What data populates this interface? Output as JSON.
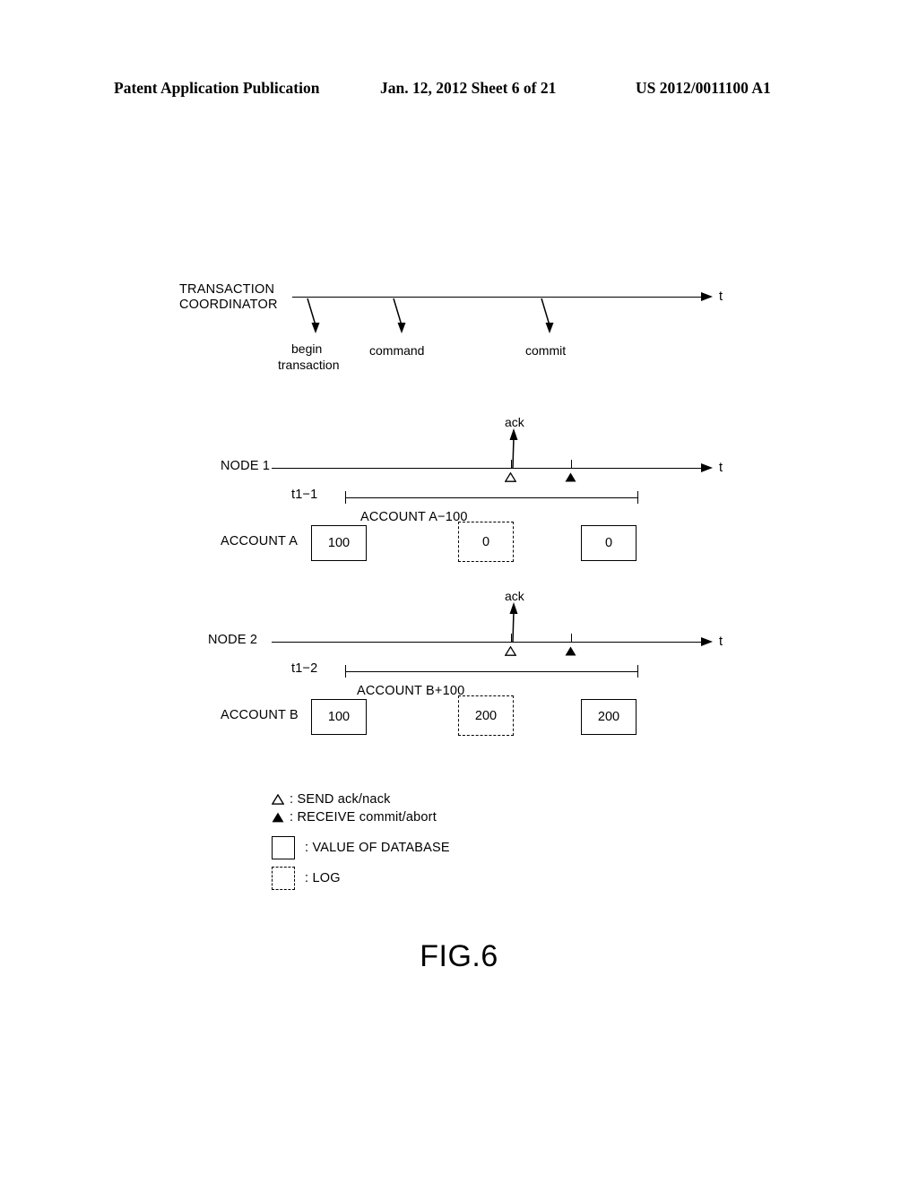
{
  "header": {
    "left": "Patent Application Publication",
    "middle": "Jan. 12, 2012  Sheet 6 of 21",
    "right": "US 2012/0011100 A1"
  },
  "figure": {
    "title": "FIG.6",
    "coordinator": {
      "label_line1": "TRANSACTION",
      "label_line2": "COORDINATOR",
      "axis_label": "t",
      "events": [
        {
          "label_line1": "begin",
          "label_line2": "transaction"
        },
        {
          "label_line1": "command",
          "label_line2": ""
        },
        {
          "label_line1": "commit",
          "label_line2": ""
        }
      ]
    },
    "nodes": [
      {
        "name": "NODE 1",
        "axis_label": "t",
        "ack_label": "ack",
        "send_marker": "open-triangle",
        "receive_marker": "filled-triangle",
        "span_label": "t1−1",
        "operation_label": "ACCOUNT A−100",
        "account_label": "ACCOUNT A",
        "boxes": [
          {
            "value": "100",
            "kind": "database"
          },
          {
            "value": "0",
            "kind": "log"
          },
          {
            "value": "0",
            "kind": "database"
          }
        ]
      },
      {
        "name": "NODE 2",
        "axis_label": "t",
        "ack_label": "ack",
        "send_marker": "open-triangle",
        "receive_marker": "filled-triangle",
        "span_label": "t1−2",
        "operation_label": "ACCOUNT B+100",
        "account_label": "ACCOUNT B",
        "boxes": [
          {
            "value": "100",
            "kind": "database"
          },
          {
            "value": "200",
            "kind": "log"
          },
          {
            "value": "200",
            "kind": "database"
          }
        ]
      }
    ],
    "legend": [
      {
        "marker": "open-triangle",
        "text": ": SEND ack/nack"
      },
      {
        "marker": "filled-triangle",
        "text": ": RECEIVE commit/abort"
      },
      {
        "marker": "solid-square",
        "text": ": VALUE OF DATABASE"
      },
      {
        "marker": "dashed-square",
        "text": ": LOG"
      }
    ]
  },
  "colors": {
    "ink": "#000000",
    "paper": "#ffffff"
  }
}
